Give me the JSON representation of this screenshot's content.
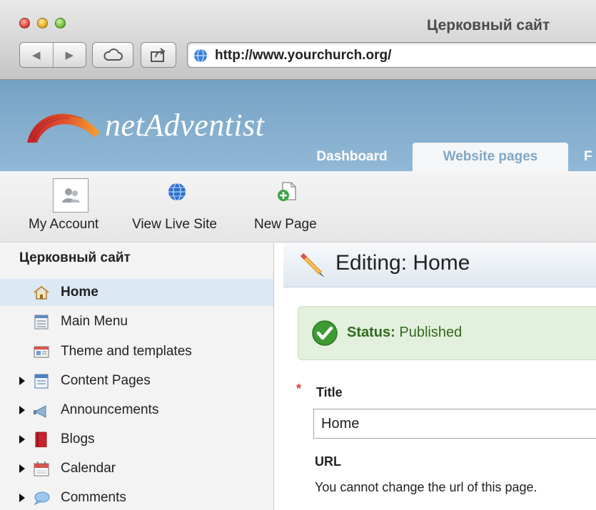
{
  "window": {
    "title": "Церковный сайт",
    "url": "http://www.yourchurch.org/",
    "back_glyph": "◀",
    "forward_glyph": "▶"
  },
  "site": {
    "logo_text": "netAdventist",
    "tabs": [
      {
        "label": "Dashboard",
        "active": false
      },
      {
        "label": "Website pages",
        "active": true
      },
      {
        "label": "F",
        "active": false
      }
    ]
  },
  "toolbar": {
    "items": [
      {
        "label": "My Account",
        "icon": "user-account-icon"
      },
      {
        "label": "View Live Site",
        "icon": "globe-icon"
      },
      {
        "label": "New Page",
        "icon": "new-page-icon"
      }
    ]
  },
  "sidebar": {
    "title": "Церковный сайт",
    "items": [
      {
        "label": "Home",
        "icon": "home-icon",
        "selected": true,
        "expandable": false
      },
      {
        "label": "Main Menu",
        "icon": "menu-icon",
        "selected": false,
        "expandable": false
      },
      {
        "label": "Theme and templates",
        "icon": "theme-icon",
        "selected": false,
        "expandable": false
      },
      {
        "label": "Content Pages",
        "icon": "content-pages-icon",
        "selected": false,
        "expandable": true
      },
      {
        "label": "Announcements",
        "icon": "announcements-icon",
        "selected": false,
        "expandable": true
      },
      {
        "label": "Blogs",
        "icon": "blogs-icon",
        "selected": false,
        "expandable": true
      },
      {
        "label": "Calendar",
        "icon": "calendar-icon",
        "selected": false,
        "expandable": true
      },
      {
        "label": "Comments",
        "icon": "comments-icon",
        "selected": false,
        "expandable": true
      }
    ]
  },
  "main": {
    "heading": "Editing: Home",
    "status_label": "Status:",
    "status_value": "Published",
    "required_marker": "*",
    "title_label": "Title",
    "title_value": "Home",
    "url_label": "URL",
    "url_note": "You cannot change the url of this page."
  },
  "colors": {
    "header_blue": "#87b0cf",
    "active_tab_text": "#7fa7c6",
    "selected_row": "#dce8f3",
    "status_green_bg": "#e3f0dd",
    "status_green_text": "#2f6b1f",
    "required_red": "#d93a2b"
  }
}
